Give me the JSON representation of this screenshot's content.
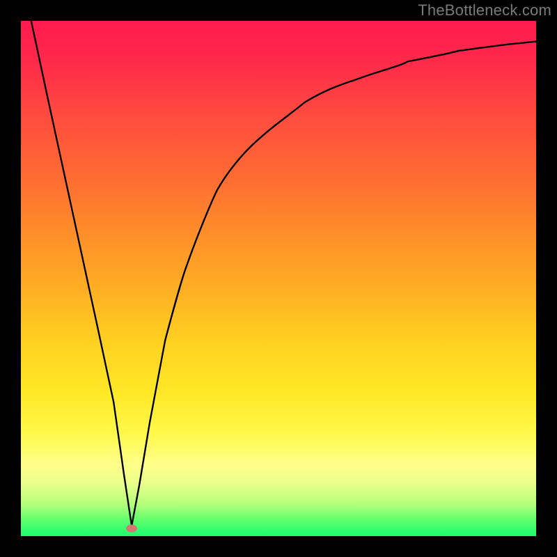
{
  "watermark": "TheBottleneck.com",
  "chart_data": {
    "type": "line",
    "title": "",
    "xlabel": "",
    "ylabel": "",
    "xlim": [
      0,
      100
    ],
    "ylim": [
      0,
      100
    ],
    "grid": false,
    "legend": false,
    "marker": {
      "x": 21.5,
      "y": 1.5,
      "color": "#d4776f"
    },
    "series": [
      {
        "name": "bottleneck-curve",
        "color": "#000000",
        "x": [
          2,
          5,
          10,
          15,
          18,
          20,
          21.5,
          23,
          25,
          28,
          32,
          38,
          45,
          55,
          65,
          75,
          85,
          95,
          100
        ],
        "y": [
          100,
          86,
          63,
          40,
          26,
          12,
          2,
          10,
          22,
          38,
          52,
          65,
          75,
          83,
          88,
          91.5,
          93.5,
          95,
          95.5
        ]
      }
    ],
    "background_gradient": {
      "top_color": "#ff1a4f",
      "bottom_color": "#1aff70"
    }
  }
}
